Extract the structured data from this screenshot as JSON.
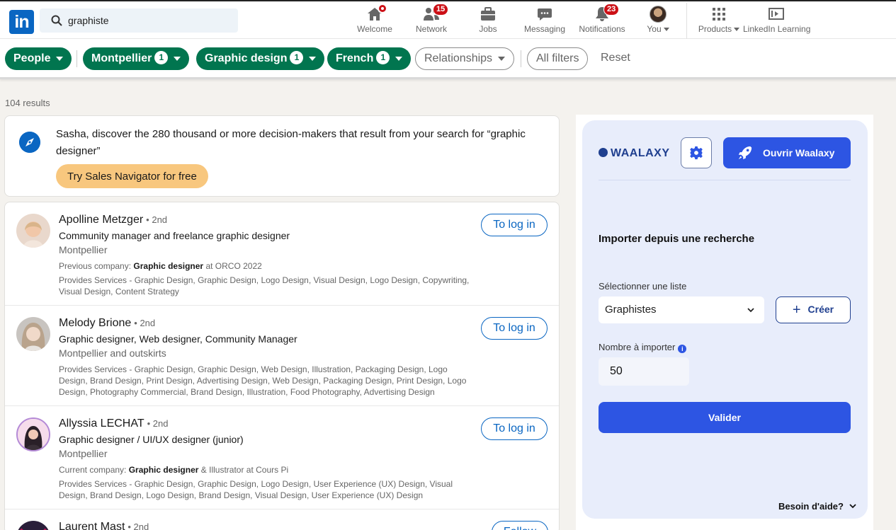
{
  "search": {
    "query": "graphiste"
  },
  "nav": {
    "items": [
      {
        "label": "Welcome",
        "badge": ""
      },
      {
        "label": "Network",
        "badge": "15"
      },
      {
        "label": "Jobs",
        "badge": ""
      },
      {
        "label": "Messaging",
        "badge": ""
      },
      {
        "label": "Notifications",
        "badge": "23"
      },
      {
        "label": "You",
        "badge": ""
      },
      {
        "label": "Products",
        "badge": ""
      },
      {
        "label": "LinkedIn Learning",
        "badge": ""
      }
    ]
  },
  "filters": {
    "people": "People",
    "location": {
      "label": "Montpellier",
      "count": "1"
    },
    "industry": {
      "label": "Graphic design",
      "count": "1"
    },
    "language": {
      "label": "French",
      "count": "1"
    },
    "relationships": "Relationships",
    "all_filters": "All filters",
    "reset": "Reset"
  },
  "results_count": "104 results",
  "promo": {
    "text": "Sasha, discover the 280 thousand or more decision-makers that result from your search for “graphic designer”",
    "button": "Try Sales Navigator for free"
  },
  "results": [
    {
      "name": "Apolline Metzger",
      "degree": "• 2nd",
      "headline": "Community manager and freelance graphic designer",
      "location": "Montpellier",
      "company_prefix": "Previous company:",
      "company_role": "Graphic designer",
      "company_suffix": "at ORCO 2022",
      "services": "Provides Services - Graphic Design, Graphic Design, Logo Design, Visual Design, Logo Design, Copywriting, Visual Design, Content Strategy",
      "action": "To log in"
    },
    {
      "name": "Melody Brione",
      "degree": "• 2nd",
      "headline": "Graphic designer, Web designer, Community Manager",
      "location": "Montpellier and outskirts",
      "services": "Provides Services - Graphic Design, Graphic Design, Web Design, Illustration, Packaging Design, Logo Design, Brand Design, Print Design, Advertising Design, Web Design, Packaging Design, Print Design, Logo Design, Photography Commercial, Brand Design, Illustration, Food Photography, Advertising Design",
      "action": "To log in"
    },
    {
      "name": "Allyssia LECHAT",
      "degree": "• 2nd",
      "headline": "Graphic designer / UI/UX designer (junior)",
      "location": "Montpellier",
      "company_prefix": "Current company:",
      "company_role": "Graphic designer",
      "company_suffix": "& Illustrator at Cours Pi",
      "services": "Provides Services - Graphic Design, Graphic Design, Logo Design, User Experience (UX) Design, Visual Design, Brand Design, Logo Design, Brand Design, Visual Design, User Experience (UX) Design",
      "action": "To log in"
    },
    {
      "name": "Laurent Mast",
      "degree": "• 2nd",
      "action": "Follow"
    }
  ],
  "waalaxy": {
    "logo": "WAALAXY",
    "open_button": "Ouvrir Waalaxy",
    "section_title": "Importer depuis une recherche",
    "list_label": "Sélectionner une liste",
    "list_value": "Graphistes",
    "create_button": "Créer",
    "count_label": "Nombre à importer",
    "count_value": "50",
    "validate_button": "Valider",
    "help": "Besoin d'aide?"
  },
  "colors": {
    "linkedin_blue": "#0a66c2",
    "filter_green": "#01754f",
    "badge_red": "#cc1016",
    "waalaxy_blue": "#2d55e3",
    "promo_button": "#f8c77e"
  }
}
